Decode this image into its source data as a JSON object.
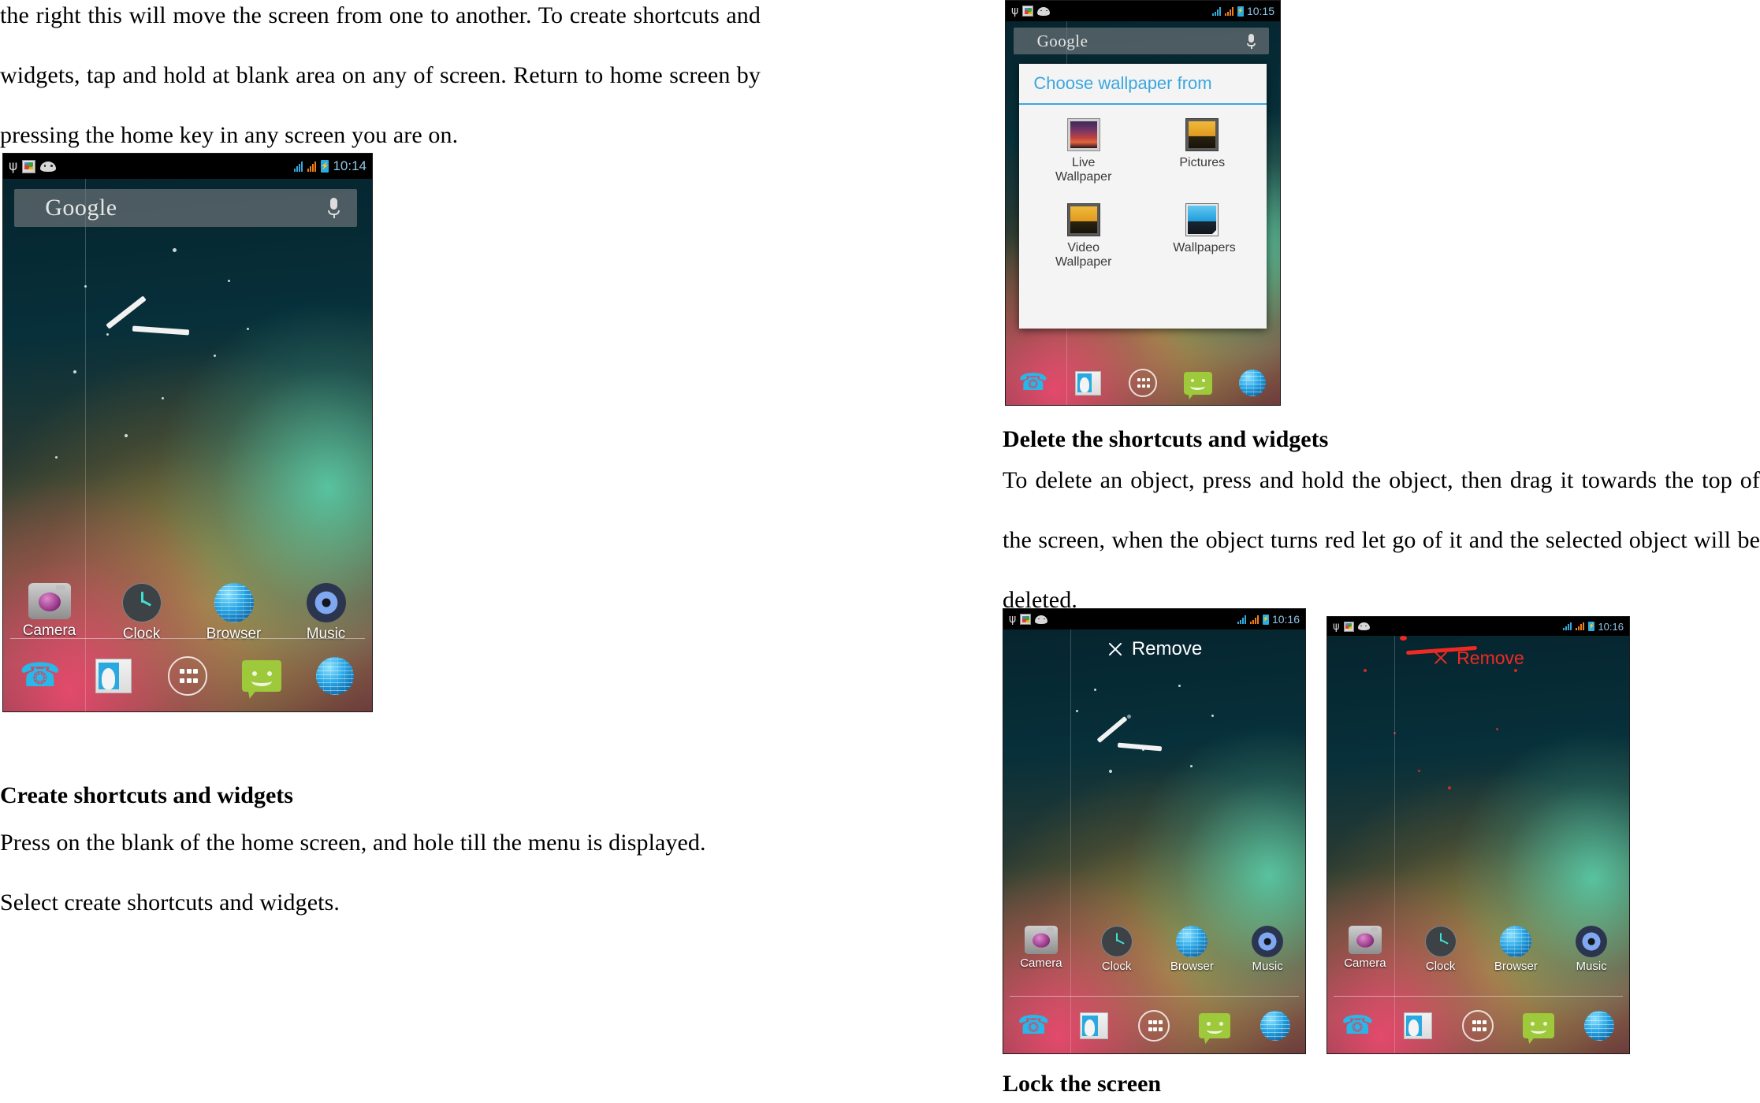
{
  "document": {
    "left_column": {
      "paragraph_1": "the right this will move the screen from one to another. To create shortcuts and widgets, tap and hold at blank area on any of screen. Return to home screen by pressing the home key in any screen you are on.",
      "heading_1": "Create shortcuts and widgets",
      "paragraph_2": "Press on the blank of the home screen, and hole till the menu is displayed. Select create shortcuts and widgets."
    },
    "right_column": {
      "heading_1": "Delete the shortcuts and widgets",
      "paragraph_1": "To delete an object, press and hold the object, then drag it towards the top of the screen, when the object turns red let go of it and the selected object will be deleted.",
      "heading_2": "Lock the screen"
    }
  },
  "figures": {
    "home_screen": {
      "status_bar": {
        "time": "10:14",
        "icons": [
          "usb-icon",
          "gallery-icon",
          "android-icon",
          "signal-bars-blue-icon",
          "signal-bars-orange-icon",
          "battery-charging-icon"
        ]
      },
      "search_widget": {
        "logo": "Google",
        "mic": "microphone-icon"
      },
      "apps": [
        {
          "label": "Camera",
          "icon": "camera-icon"
        },
        {
          "label": "Clock",
          "icon": "clock-icon"
        },
        {
          "label": "Browser",
          "icon": "browser-icon"
        },
        {
          "label": "Music",
          "icon": "music-icon"
        }
      ],
      "dock": [
        {
          "icon": "phone-icon"
        },
        {
          "icon": "contacts-icon"
        },
        {
          "icon": "all-apps-icon"
        },
        {
          "icon": "messaging-icon"
        },
        {
          "icon": "browser-icon"
        }
      ]
    },
    "wallpaper_picker": {
      "status_bar": {
        "time": "10:15"
      },
      "search_widget": {
        "logo": "Google"
      },
      "dialog": {
        "title": "Choose wallpaper from",
        "accent_color": "#3ba7dd",
        "options": [
          {
            "label": "Live Wallpaper",
            "icon": "live-wallpaper-icon"
          },
          {
            "label": "Pictures",
            "icon": "pictures-icon"
          },
          {
            "label": "Video Wallpaper",
            "icon": "video-wallpaper-icon"
          },
          {
            "label": "Wallpapers",
            "icon": "wallpapers-icon"
          }
        ]
      },
      "dock": [
        {
          "icon": "phone-icon"
        },
        {
          "icon": "contacts-icon"
        },
        {
          "icon": "all-apps-icon"
        },
        {
          "icon": "messaging-icon"
        },
        {
          "icon": "browser-icon"
        }
      ]
    },
    "remove_white": {
      "status_bar": {
        "time": "10:16"
      },
      "remove_label": "Remove",
      "remove_color": "#ffffff",
      "apps": [
        {
          "label": "Camera",
          "icon": "camera-icon"
        },
        {
          "label": "Clock",
          "icon": "clock-icon"
        },
        {
          "label": "Browser",
          "icon": "browser-icon"
        },
        {
          "label": "Music",
          "icon": "music-icon"
        }
      ],
      "dock": [
        {
          "icon": "phone-icon"
        },
        {
          "icon": "contacts-icon"
        },
        {
          "icon": "all-apps-icon"
        },
        {
          "icon": "messaging-icon"
        },
        {
          "icon": "browser-icon"
        }
      ]
    },
    "remove_red": {
      "status_bar": {
        "time": "10:16"
      },
      "remove_label": "Remove",
      "remove_color": "#f02a22",
      "apps": [
        {
          "label": "Camera",
          "icon": "camera-icon"
        },
        {
          "label": "Clock",
          "icon": "clock-icon"
        },
        {
          "label": "Browser",
          "icon": "browser-icon"
        },
        {
          "label": "Music",
          "icon": "music-icon"
        }
      ],
      "dock": [
        {
          "icon": "phone-icon"
        },
        {
          "icon": "contacts-icon"
        },
        {
          "icon": "all-apps-icon"
        },
        {
          "icon": "messaging-icon"
        },
        {
          "icon": "browser-icon"
        }
      ]
    }
  }
}
